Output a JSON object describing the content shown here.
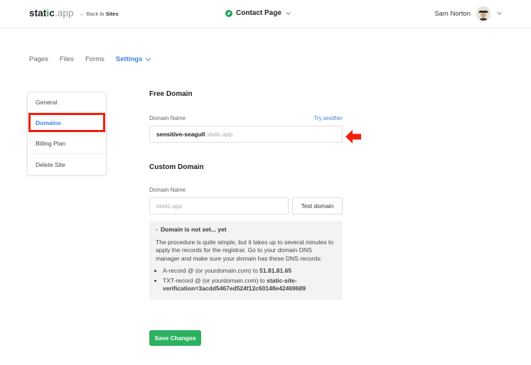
{
  "header": {
    "logo_main": "stat",
    "logo_i": "i",
    "logo_rest": "c",
    "logo_suffix": ".app",
    "back_prefix": "← Back to ",
    "back_target": "Sites",
    "site_title": "Contact Page",
    "user_name": "Sam Norton"
  },
  "tabs": {
    "pages": "Pages",
    "files": "Files",
    "forms": "Forms",
    "settings": "Settings"
  },
  "sidebar": {
    "items": [
      {
        "label": "General"
      },
      {
        "label": "Domains"
      },
      {
        "label": "Billing Plan"
      },
      {
        "label": "Delete Site"
      }
    ]
  },
  "free_domain": {
    "title": "Free Domain",
    "field_label": "Domain Name",
    "try_another": "Try another",
    "subdomain": "sensitive-seagull",
    "suffix": ".static.app"
  },
  "custom_domain": {
    "title": "Custom Domain",
    "field_label": "Domain Name",
    "placeholder": "static.app",
    "test_button": "Test domain",
    "info_title": "Domain is not set... yet",
    "info_text": "The procedure is quite simple, but it takes up to several minutes to apply the records for the registrar. Go to your domain DNS manager and make sure your domain has these DNS records:",
    "a_record_prefix": "A-record @ (or yourdomain.com) to ",
    "a_record_value": "51.81.81.65",
    "txt_record_prefix": "TXT-record @ (or yourdomain.com) to ",
    "txt_record_value": "static-site-verification=3acdd5467ed524f12c60148e42469689"
  },
  "footer": {
    "save_label": "Save Changes"
  },
  "colors": {
    "accent_blue": "#3b82d8",
    "brand_green": "#2bb160",
    "highlight_red": "#f21e0a"
  }
}
